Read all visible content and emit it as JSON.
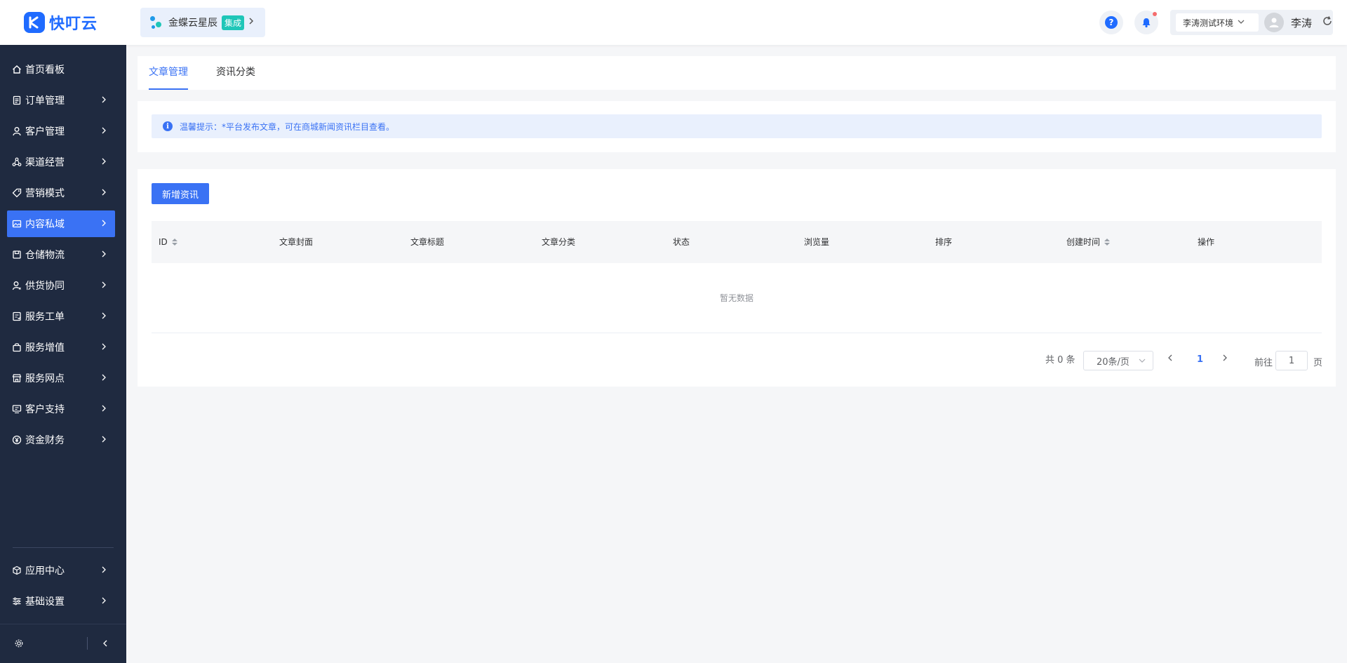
{
  "header": {
    "logo_text": "快叮云",
    "integration": {
      "name": "金蝶云星辰",
      "badge": "集成"
    },
    "environment": "李涛测试环境",
    "user_name": "李涛",
    "help_glyph": "?"
  },
  "sidebar": {
    "items": [
      {
        "label": "首页看板",
        "icon": "home-icon"
      },
      {
        "label": "订单管理",
        "icon": "order-icon"
      },
      {
        "label": "客户管理",
        "icon": "user-icon"
      },
      {
        "label": "渠道经营",
        "icon": "channel-icon"
      },
      {
        "label": "营销模式",
        "icon": "tag-icon"
      },
      {
        "label": "内容私域",
        "icon": "image-icon",
        "active": true
      },
      {
        "label": "仓储物流",
        "icon": "warehouse-icon"
      },
      {
        "label": "供货协同",
        "icon": "supply-icon"
      },
      {
        "label": "服务工单",
        "icon": "ticket-icon"
      },
      {
        "label": "服务增值",
        "icon": "bag-icon"
      },
      {
        "label": "服务网点",
        "icon": "store-icon"
      },
      {
        "label": "客户支持",
        "icon": "support-icon"
      },
      {
        "label": "资金财务",
        "icon": "yen-icon"
      }
    ],
    "bottom_items": [
      {
        "label": "应用中心",
        "icon": "cube-icon"
      },
      {
        "label": "基础设置",
        "icon": "settings-icon"
      }
    ]
  },
  "tabs": [
    {
      "label": "文章管理",
      "active": true
    },
    {
      "label": "资讯分类",
      "active": false
    }
  ],
  "notice": {
    "text": "温馨提示：*平台发布文章，可在商城新闻资讯栏目查看。",
    "icon_glyph": "i"
  },
  "toolbar": {
    "add_label": "新增资讯"
  },
  "table": {
    "columns": [
      {
        "label": "ID",
        "sortable": true
      },
      {
        "label": "文章封面",
        "sortable": false
      },
      {
        "label": "文章标题",
        "sortable": false
      },
      {
        "label": "文章分类",
        "sortable": false
      },
      {
        "label": "状态",
        "sortable": false
      },
      {
        "label": "浏览量",
        "sortable": false
      },
      {
        "label": "排序",
        "sortable": false
      },
      {
        "label": "创建时间",
        "sortable": true
      },
      {
        "label": "操作",
        "sortable": false
      }
    ],
    "empty_text": "暂无数据"
  },
  "pagination": {
    "total_text": "共 0 条",
    "page_size": "20条/页",
    "current_page": "1",
    "goto_label": "前往",
    "goto_value": "1",
    "page_suffix": "页"
  },
  "colors": {
    "primary": "#3a72f4",
    "sidebar_bg": "#1f2a40",
    "brand": "#1f6bff"
  }
}
